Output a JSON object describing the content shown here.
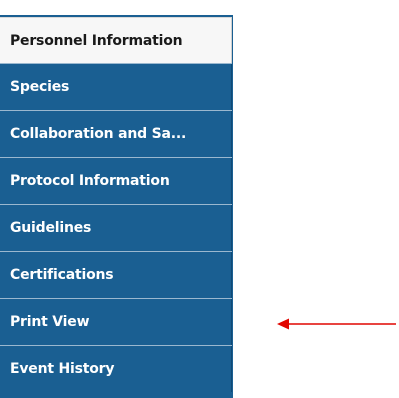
{
  "nav": {
    "items": [
      {
        "label": "Personnel Information",
        "active": true
      },
      {
        "label": "Species",
        "active": false
      },
      {
        "label": "Collaboration and Sa...",
        "active": false
      },
      {
        "label": "Protocol Information",
        "active": false
      },
      {
        "label": "Guidelines",
        "active": false
      },
      {
        "label": "Certifications",
        "active": false
      },
      {
        "label": "Print View",
        "active": false
      },
      {
        "label": "Event History",
        "active": false
      }
    ]
  },
  "annotation": {
    "arrow_color": "#e10600",
    "points_to": "Print View"
  },
  "colors": {
    "nav_blue": "#1a5f92",
    "active_bg": "#f7f7f7"
  }
}
